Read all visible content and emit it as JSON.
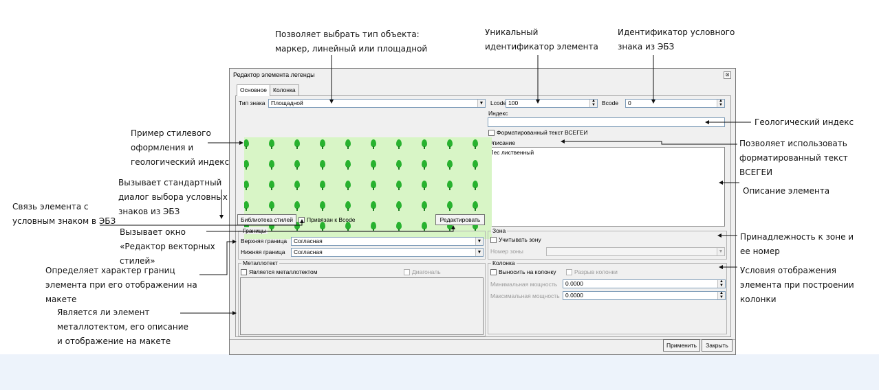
{
  "dialog": {
    "title": "Редактор элемента легенды",
    "close_glyph": "⊠",
    "tabs": [
      "Основное",
      "Колонка"
    ],
    "sign_type": {
      "label": "Тип знака",
      "value": "Площадной"
    },
    "lcode": {
      "label": "Lcode",
      "value": "100"
    },
    "bcode": {
      "label": "Bcode",
      "value": "0"
    },
    "index": {
      "label": "Индекс",
      "value": ""
    },
    "formatted_text": {
      "label": "Форматированный текст ВСЕГЕИ",
      "checked": false
    },
    "description": {
      "label": "Описание",
      "value": "Лес лиственный"
    },
    "style_library_button": "Библиотека стилей",
    "bound_bcode": {
      "label": "Привязан к Bcode",
      "checked": false
    },
    "edit_button": "Редактировать",
    "borders": {
      "title": "Границы",
      "upper_label": "Верхняя граница",
      "upper_value": "Согласная",
      "lower_label": "Нижняя граница",
      "lower_value": "Согласная"
    },
    "zone": {
      "title": "Зона",
      "consider_label": "Учитывать зону",
      "number_label": "Номер зоны",
      "number_value": ""
    },
    "metallotect": {
      "title": "Металлотект",
      "is_label": "Является металлотектом",
      "diagonal_label": "Диагональ"
    },
    "column": {
      "title": "Колонка",
      "show_label": "Выносить на колонку",
      "break_label": "Разрыв колонки",
      "min_label": "Минимальная мощность",
      "min_value": "0.0000",
      "max_label": "Максимальная мощность",
      "max_value": "0.0000"
    },
    "apply_button": "Применить",
    "close_button": "Закрыть"
  },
  "preview": {
    "pattern": "tree-icon",
    "background": "#d8f5c6",
    "tree_color": "#28b22f"
  },
  "annotations": {
    "type_select": "Позволяет выбрать тип объекта:\nмаркер, линейный или площадной",
    "unique_id": "Уникальный\nидентификатор элемента",
    "ebz_id": "Идентификатор условного\nзнака из ЭБЗ",
    "geo_index": "Геологический индекс",
    "style_example": "Пример стилевого\nоформления и\nгеологический индекс",
    "formatted_text": "Позволяет использовать\nформатированный текст\nВСЕГЕИ",
    "std_dialog": "Вызывает стандартный\nдиалог выбора условных\nзнаков из ЭБЗ",
    "description": "Описание элемента",
    "link_ebz": "Связь элемента с\nусловным знаком в ЭБЗ",
    "vector_editor": "Вызывает окно\n«Редактор векторных\nстилей»",
    "zone_membership": "Принадлежность к зоне и\nее номер",
    "borders_character": "Определяет характер границ\nэлемента при его отображении на\nмакете",
    "column_conditions": "Условия отображения\nэлемента при построении\nколонки",
    "metallotect_info": "Является ли элемент\nметаллотектом, его описание\nи отображение на макете"
  }
}
